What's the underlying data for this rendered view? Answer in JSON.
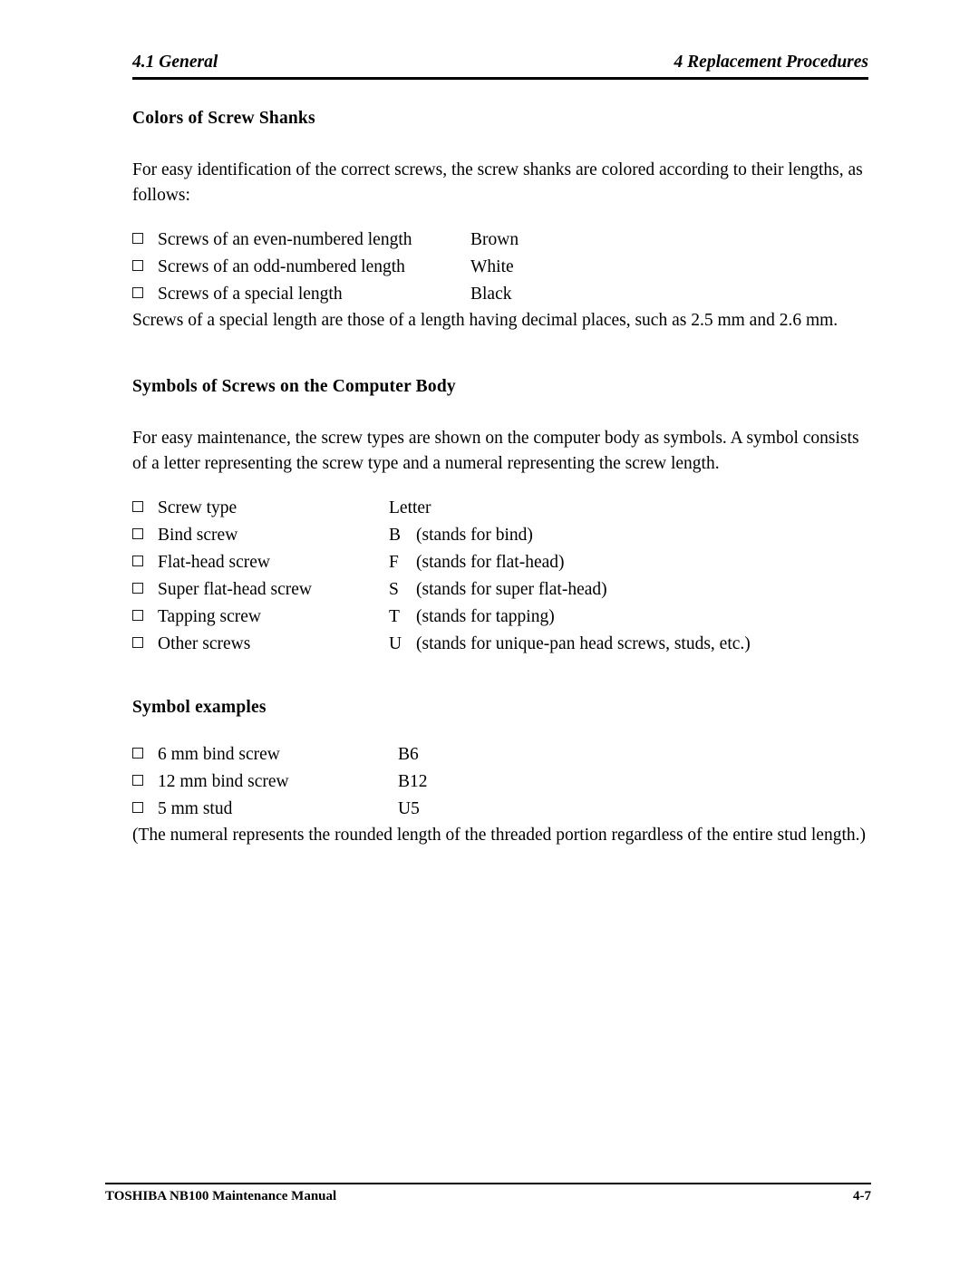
{
  "header": {
    "left": "4.1 General",
    "right": "4 Replacement Procedures"
  },
  "sections": {
    "colors": {
      "title": "Colors of Screw Shanks",
      "intro": "For easy identification of the correct screws, the screw shanks are colored according to their lengths, as follows:",
      "items": [
        {
          "label": "Screws of an even-numbered length",
          "value": "Brown"
        },
        {
          "label": "Screws of an odd-numbered length",
          "value": "White"
        },
        {
          "label": "Screws of a special length",
          "value": "Black"
        }
      ],
      "note": "Screws of a special length are those of a length having decimal places, such as 2.5 mm and 2.6 mm."
    },
    "symbols": {
      "title": "Symbols of Screws on the Computer Body",
      "intro": "For easy maintenance, the screw types are shown on the computer body as symbols. A symbol consists of a letter representing the screw type and a numeral representing the screw length.",
      "items": [
        {
          "label": "Screw type",
          "letter": "Letter",
          "desc": ""
        },
        {
          "label": "Bind screw",
          "letter": "B",
          "desc": "(stands for bind)"
        },
        {
          "label": "Flat-head screw",
          "letter": "F",
          "desc": "(stands for flat-head)"
        },
        {
          "label": "Super flat-head screw",
          "letter": "S",
          "desc": "(stands for super flat-head)"
        },
        {
          "label": "Tapping screw",
          "letter": "T",
          "desc": "(stands for tapping)"
        },
        {
          "label": "Other screws",
          "letter": "U",
          "desc": "(stands for unique-pan head screws, studs, etc.)"
        }
      ]
    },
    "examples": {
      "title": "Symbol examples",
      "items": [
        {
          "label": "6 mm bind screw",
          "value": "B6"
        },
        {
          "label": "12 mm bind screw",
          "value": "B12"
        },
        {
          "label": "5 mm stud",
          "value": "U5"
        }
      ],
      "note": "(The numeral represents the rounded length of the threaded portion regardless of the entire stud length.)"
    }
  },
  "footer": {
    "left": "TOSHIBA NB100 Maintenance Manual",
    "right": "4-7"
  }
}
